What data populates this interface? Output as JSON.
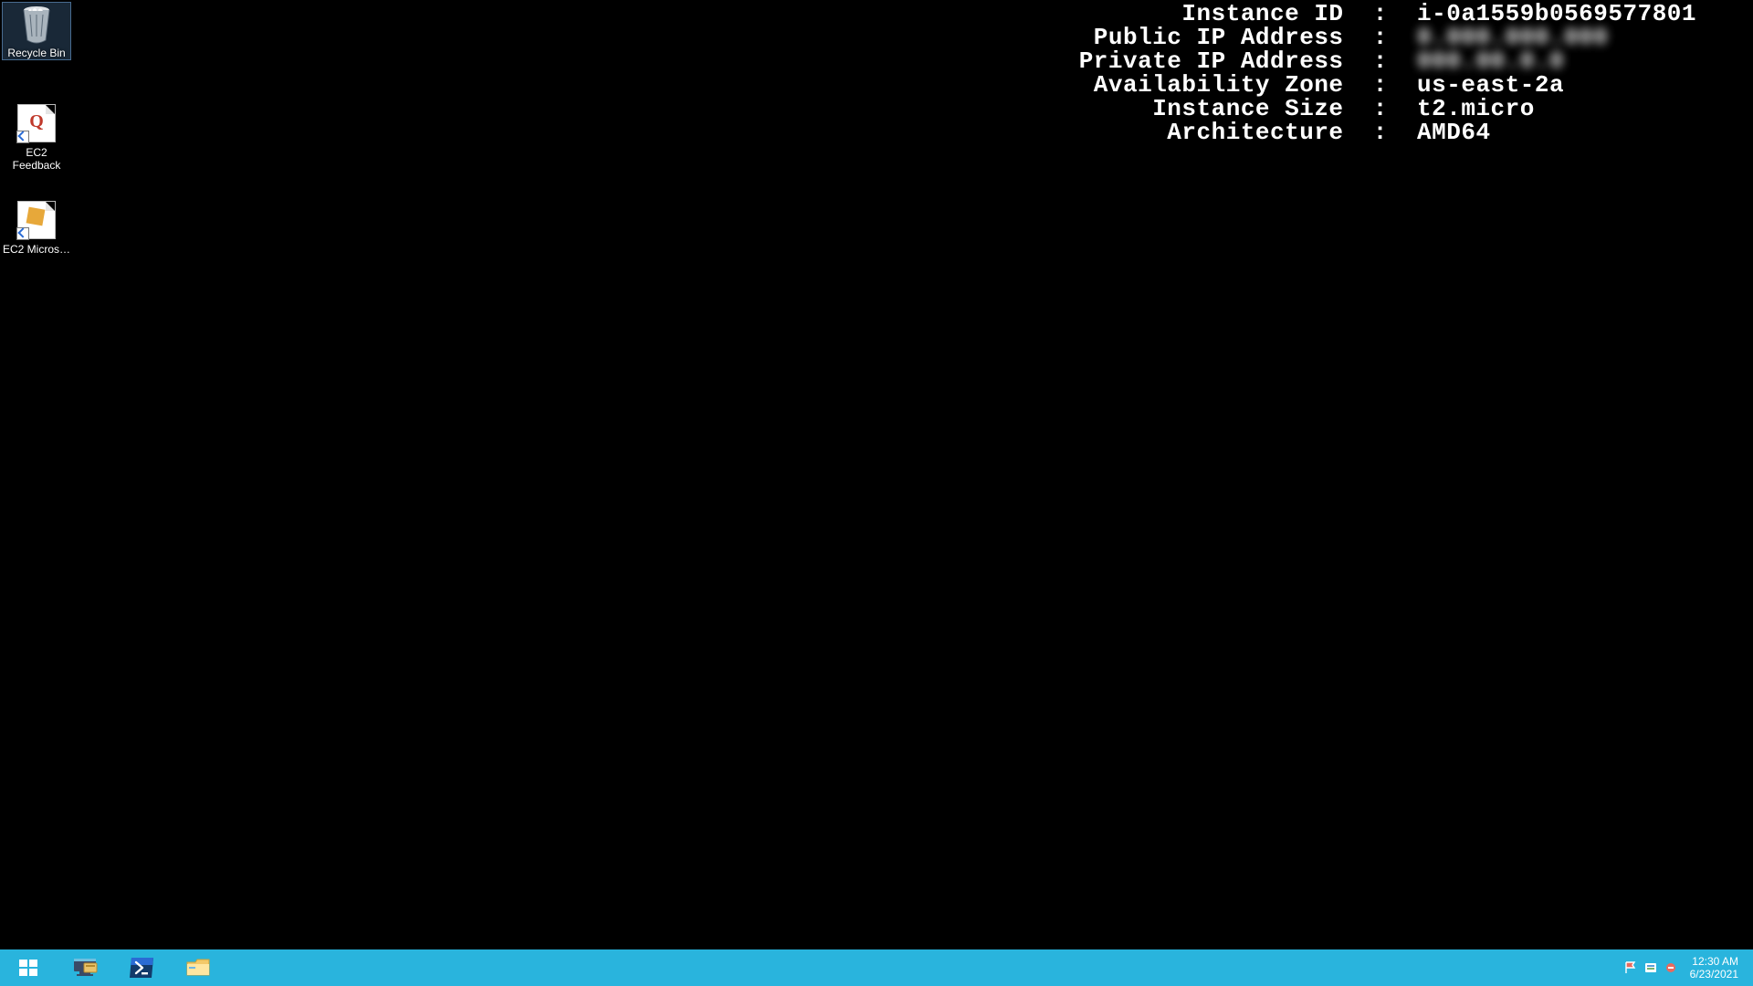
{
  "desktop_icons": {
    "recycle_bin": {
      "label": "Recycle Bin"
    },
    "ec2_feedback": {
      "label": "EC2 Feedback"
    },
    "ec2_ms": {
      "label": "EC2 Micros…"
    }
  },
  "wallpaper_info": {
    "rows": [
      {
        "label": "Instance ID",
        "value": "i-0a1559b0569577801",
        "blur": false
      },
      {
        "label": "Public IP Address",
        "value": "0.000.000.000",
        "blur": true
      },
      {
        "label": "Private IP Address",
        "value": "000.00.0.0",
        "blur": true
      },
      {
        "label": "Availability Zone",
        "value": "us-east-2a",
        "blur": false
      },
      {
        "label": "Instance Size",
        "value": "t2.micro",
        "blur": false
      },
      {
        "label": "Architecture",
        "value": "AMD64",
        "blur": false
      }
    ]
  },
  "taskbar": {
    "start": "Start",
    "server_mgr": "Server Manager",
    "powershell": "Windows PowerShell",
    "explorer": "File Explorer"
  },
  "tray": {
    "flag": "Action Center",
    "safety": "Windows Security",
    "safe_remove": "Safely Remove Hardware"
  },
  "clock": {
    "time": "12:30 AM",
    "date": "6/23/2021"
  }
}
